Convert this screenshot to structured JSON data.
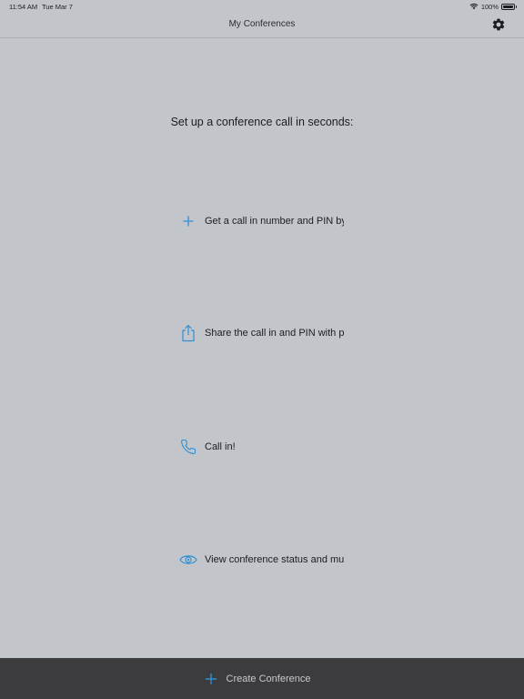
{
  "status_bar": {
    "time": "11:54 AM",
    "date": "Tue Mar 7",
    "battery": "100%"
  },
  "nav": {
    "title": "My Conferences",
    "settings_icon": "gear-icon"
  },
  "intro": "Set up a conference call in seconds:",
  "steps": [
    {
      "icon": "plus-icon",
      "text": "Get a call in number and PIN by"
    },
    {
      "icon": "share-icon",
      "text": "Share the call in and PIN with pa"
    },
    {
      "icon": "phone-icon",
      "text": "Call in!"
    },
    {
      "icon": "eye-icon",
      "text": "View conference status and mu"
    }
  ],
  "bottom": {
    "create_label": "Create Conference",
    "icon": "plus-icon"
  },
  "colors": {
    "background": "#c2c6ca",
    "accent": "#2e8fd4",
    "bottom_bar": "#3c3c3e"
  }
}
